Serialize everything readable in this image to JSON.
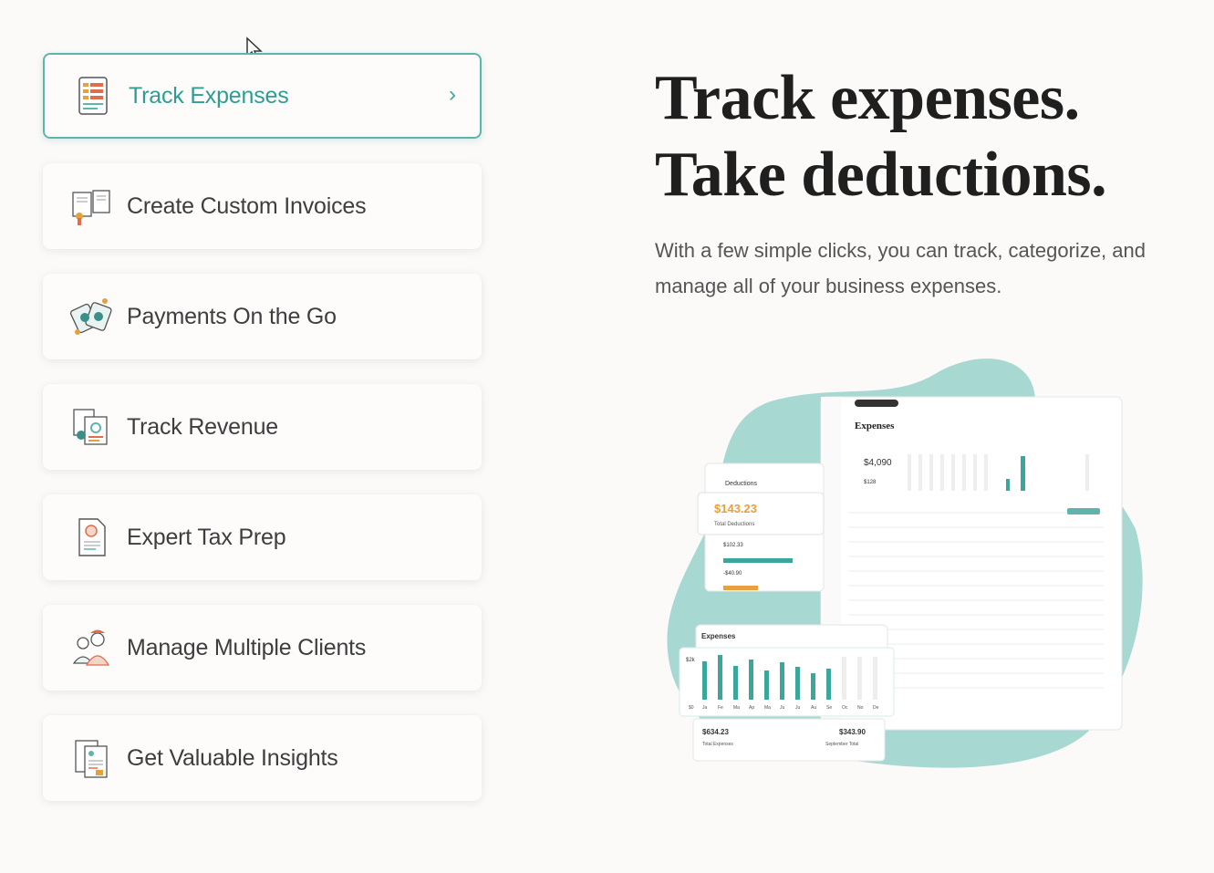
{
  "menu": {
    "items": [
      {
        "label": "Track Expenses",
        "active": true
      },
      {
        "label": "Create Custom Invoices",
        "active": false
      },
      {
        "label": "Payments On the Go",
        "active": false
      },
      {
        "label": "Track Revenue",
        "active": false
      },
      {
        "label": "Expert Tax Prep",
        "active": false
      },
      {
        "label": "Manage Multiple Clients",
        "active": false
      },
      {
        "label": "Get Valuable Insights",
        "active": false
      }
    ],
    "chevron": "›"
  },
  "hero": {
    "title_line1": "Track expenses.",
    "title_line2": "Take deductions.",
    "subtitle": "With a few simple clicks, you can track, categorize, and manage all of your business expenses."
  },
  "mockup": {
    "main_title": "Expenses",
    "main_amount": "$4,090",
    "main_amount_small": "$128",
    "deductions_title": "Deductions",
    "deductions_amount": "$143.23",
    "deductions_label": "Total Deductions",
    "deduction_row1": "$102.33",
    "deduction_row2": "-$40.90",
    "expenses_card_title": "Expenses",
    "expenses_card_axis_top": "$2k",
    "months": [
      "$0",
      "Ja",
      "Fe",
      "Ma",
      "Ap",
      "Ma",
      "Ju",
      "Ju",
      "Au",
      "Se",
      "Oc",
      "No",
      "De"
    ],
    "total_expenses_amount": "$634.23",
    "total_expenses_label": "Total Expenses",
    "september_total_amount": "$343.90",
    "september_total_label": "September Total"
  },
  "colors": {
    "accent": "#5fb5ad",
    "accent_text": "#2e9d93",
    "orange": "#e8a03c",
    "blob": "#a8d8d2"
  }
}
